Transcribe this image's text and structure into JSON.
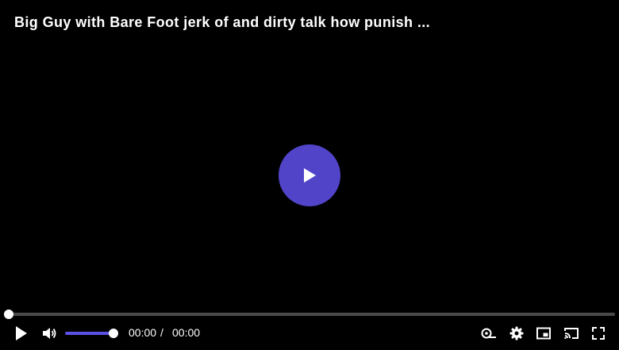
{
  "video": {
    "title": "Big Guy with Bare Foot jerk of and dirty talk how punish ...",
    "accent_color": "#5144c9"
  },
  "controls": {
    "current_time": "00:00",
    "separator": "/",
    "duration": "00:00",
    "progress": 0,
    "volume": 1,
    "icons": [
      "play-icon",
      "volume-icon",
      "quality-icon",
      "settings-icon",
      "pip-icon",
      "cast-icon",
      "fullscreen-icon"
    ]
  }
}
